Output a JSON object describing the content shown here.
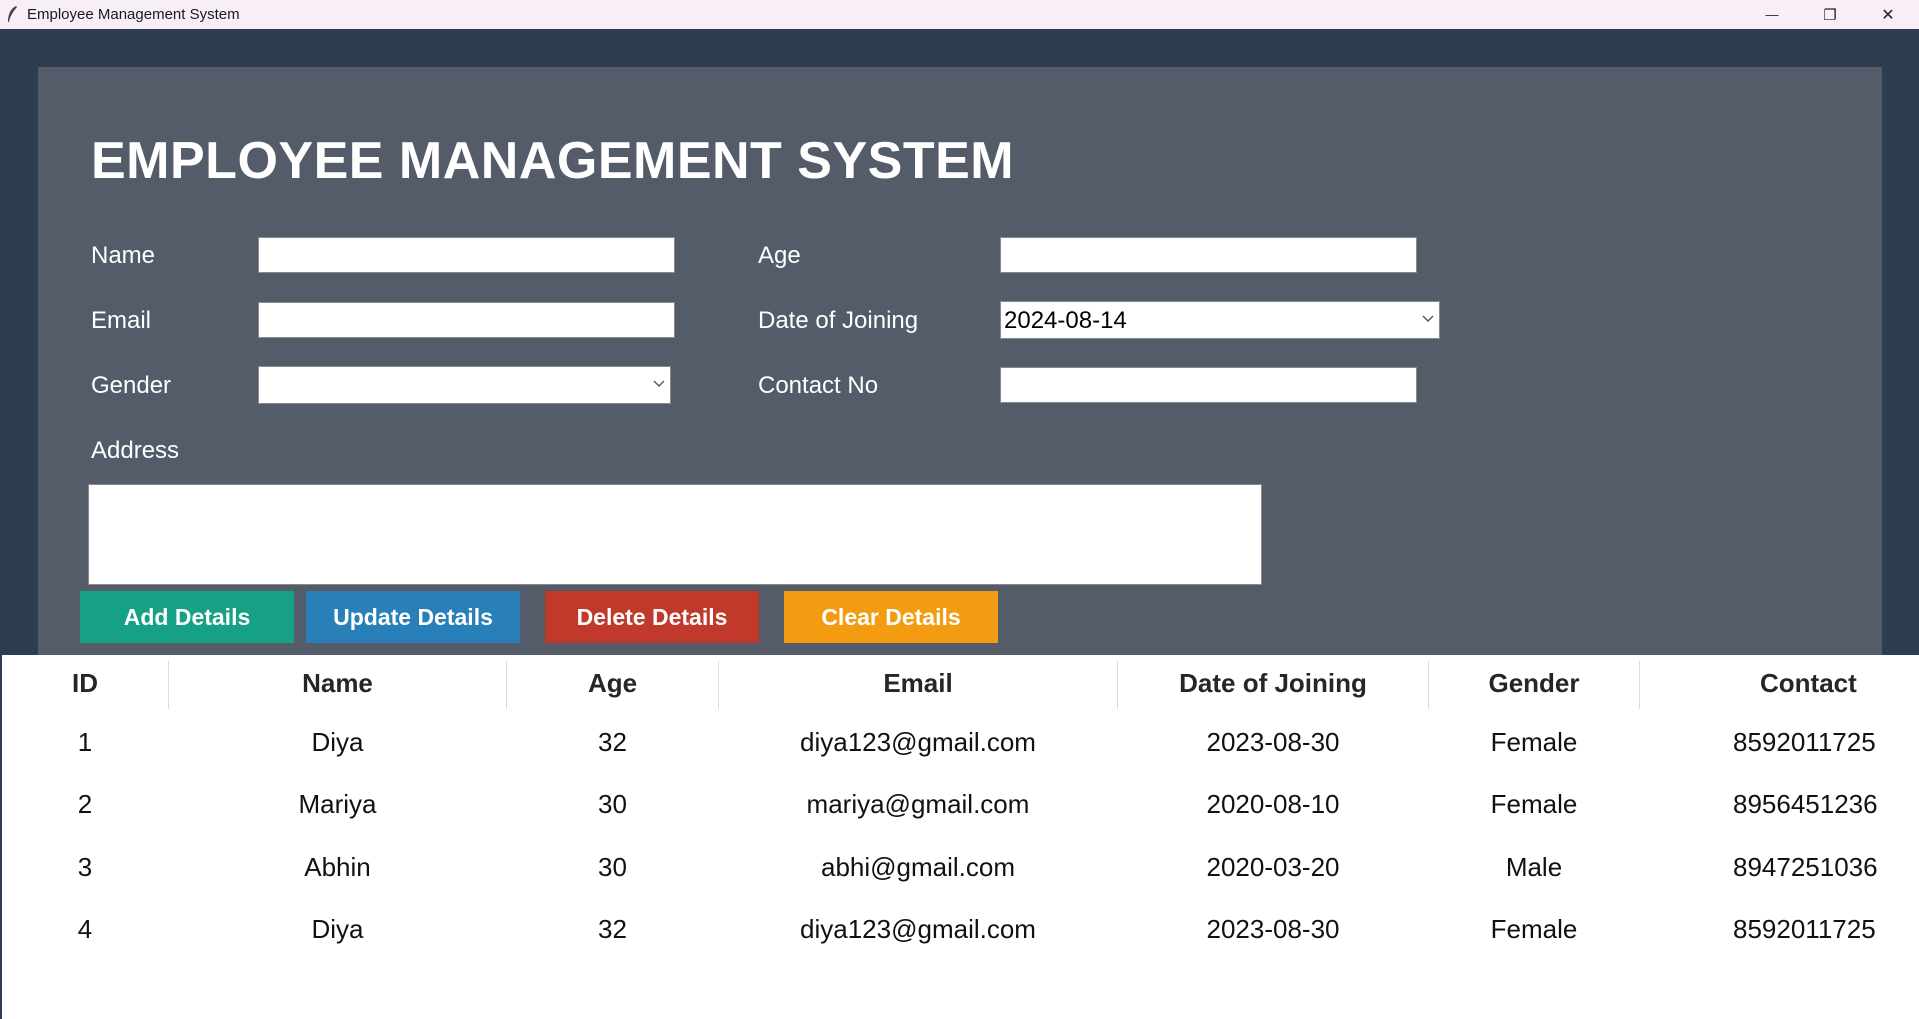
{
  "window": {
    "title": "Employee Management System",
    "minimize_glyph": "—",
    "restore_glyph": "❐",
    "close_glyph": "✕"
  },
  "header": {
    "title": "EMPLOYEE MANAGEMENT SYSTEM"
  },
  "form": {
    "name_label": "Name",
    "name_value": "",
    "age_label": "Age",
    "age_value": "",
    "email_label": "Email",
    "email_value": "",
    "doj_label": "Date of Joining",
    "doj_value": "2024-08-14",
    "gender_label": "Gender",
    "gender_value": "",
    "contact_label": "Contact No",
    "contact_value": "",
    "address_label": "Address",
    "address_value": ""
  },
  "buttons": {
    "add": "Add Details",
    "update": "Update Details",
    "delete": "Delete Details",
    "clear": "Clear Details"
  },
  "colors": {
    "add": "#16a085",
    "update": "#2980b9",
    "delete": "#c0392b",
    "clear": "#f39c12",
    "frame_bg": "#545b69",
    "outer_bg": "#2e3e50"
  },
  "table": {
    "columns": [
      "ID",
      "Name",
      "Age",
      "Email",
      "Date of Joining",
      "Gender",
      "Contact"
    ],
    "rows": [
      [
        "1",
        "Diya",
        "32",
        "diya123@gmail.com",
        "2023-08-30",
        "Female",
        "8592011725"
      ],
      [
        "2",
        "Mariya",
        "30",
        "mariya@gmail.com",
        "2020-08-10",
        "Female",
        "8956451236"
      ],
      [
        "3",
        "Abhin",
        "30",
        "abhi@gmail.com",
        "2020-03-20",
        "Male",
        "8947251036"
      ],
      [
        "4",
        "Diya",
        "32",
        "diya123@gmail.com",
        "2023-08-30",
        "Female",
        "8592011725"
      ]
    ]
  }
}
